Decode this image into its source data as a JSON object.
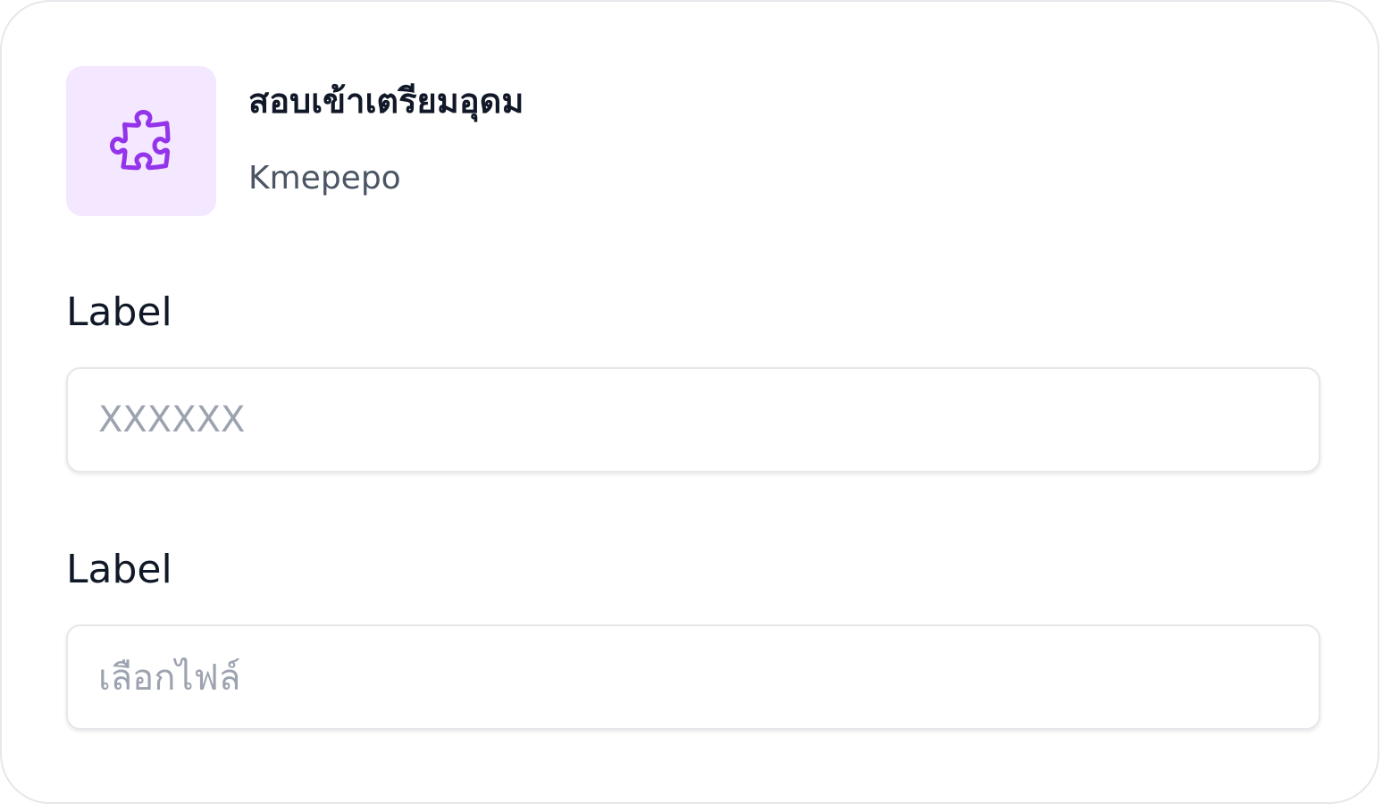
{
  "header": {
    "icon": "puzzle-icon",
    "icon_color": "#9333ea",
    "icon_bg": "#f3e8ff",
    "title": "สอบเข้าเตรียมอุดม",
    "subtitle": "Kmepepo"
  },
  "form": {
    "field_1": {
      "label": "Label",
      "placeholder": "XXXXXX",
      "value": ""
    },
    "field_2": {
      "label": "Label",
      "placeholder": "เลือกไฟล์"
    }
  }
}
